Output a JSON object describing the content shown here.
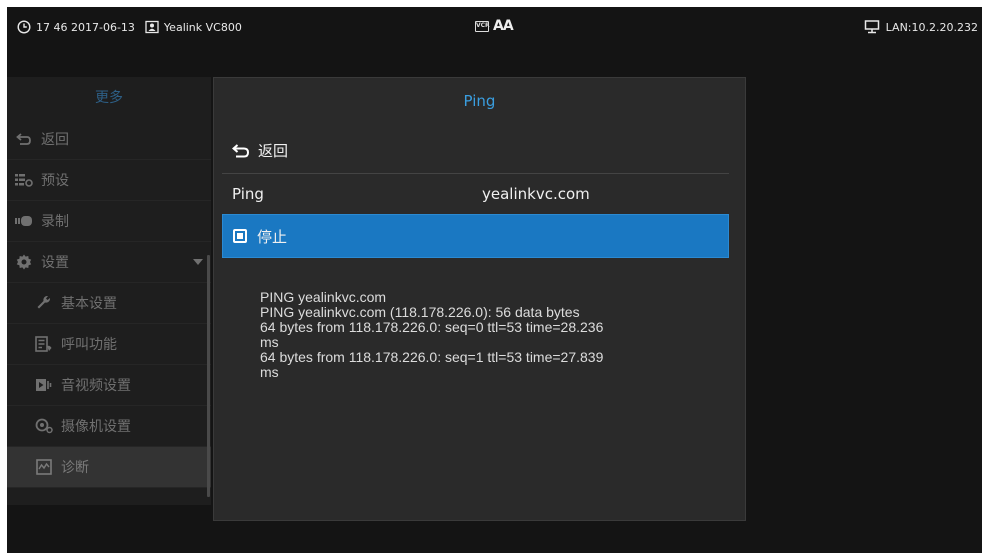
{
  "statusbar": {
    "datetime": "17 46 2017-06-13",
    "device": "Yealink VC800",
    "vcr_badge": "VCR",
    "font_badge": "AA",
    "network": "LAN:10.2.20.232",
    "icons": [
      "clock-icon",
      "contact-card-icon",
      "vcr-icon",
      "font-size-icon",
      "lan-monitor-icon"
    ]
  },
  "menu": {
    "title": "更多",
    "items": [
      {
        "label": "返回",
        "icon": "back-icon"
      },
      {
        "label": "预设",
        "icon": "preset-icon"
      },
      {
        "label": "录制",
        "icon": "record-icon"
      },
      {
        "label": "设置",
        "icon": "gear-icon"
      },
      {
        "label": "基本设置",
        "icon": "wrench-icon"
      },
      {
        "label": "呼叫功能",
        "icon": "call-feature-icon"
      },
      {
        "label": "音视频设置",
        "icon": "audio-video-icon"
      },
      {
        "label": "摄像机设置",
        "icon": "camera-icon"
      },
      {
        "label": "诊断",
        "icon": "diagnostics-icon"
      }
    ]
  },
  "panel": {
    "title": "Ping",
    "back_label": "返回",
    "ping_label": "Ping",
    "ping_value": "yealinkvc.com",
    "stop_label": "停止",
    "output_lines": [
      "PING yealinkvc.com",
      "PING yealinkvc.com (118.178.226.0): 56 data bytes",
      "64 bytes from 118.178.226.0: seq=0 ttl=53 time=28.236",
      "ms",
      "64 bytes from 118.178.226.0: seq=1 ttl=53 time=27.839",
      "ms"
    ]
  },
  "colors": {
    "accent": "#1a78c2",
    "title_blue": "#3a9ee0",
    "menu_title": "#2d5f86"
  }
}
